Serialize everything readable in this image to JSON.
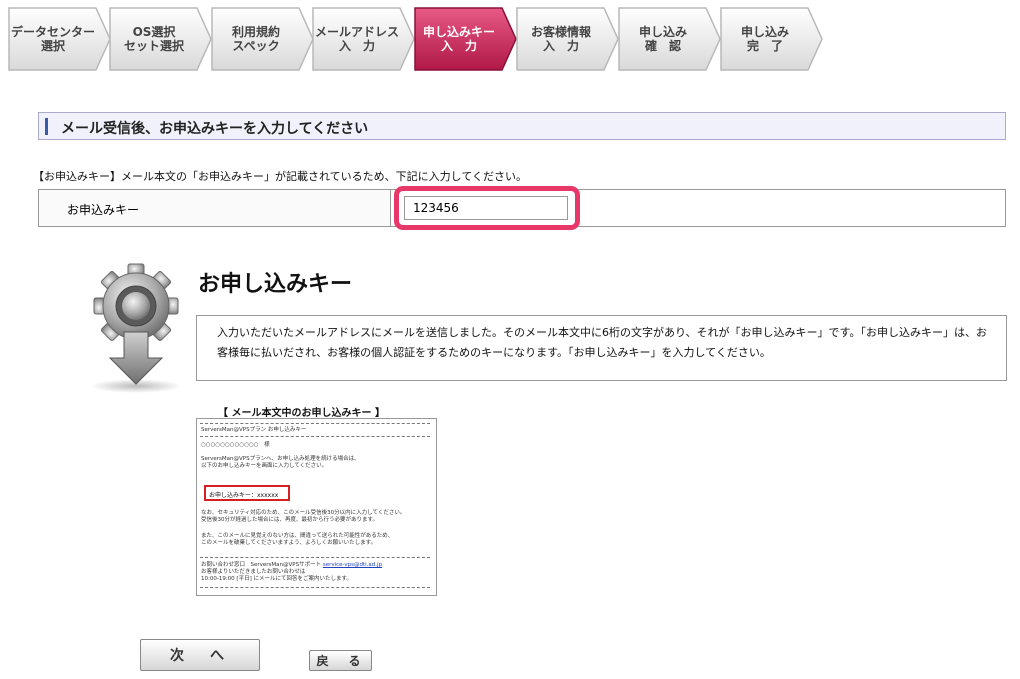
{
  "steps": [
    {
      "line1": "データセンター",
      "line2": "選択",
      "active": false
    },
    {
      "line1": "OS選択",
      "line2": "セット選択",
      "active": false
    },
    {
      "line1": "利用規約",
      "line2": "スペック",
      "active": false
    },
    {
      "line1": "メールアドレス",
      "line2": "入　力",
      "active": false
    },
    {
      "line1": "申し込みキー",
      "line2": "入　力",
      "active": true
    },
    {
      "line1": "お客様情報",
      "line2": "入　力",
      "active": false
    },
    {
      "line1": "申し込み",
      "line2": "確　認",
      "active": false
    },
    {
      "line1": "申し込み",
      "line2": "完　了",
      "active": false
    }
  ],
  "heading": "メール受信後、お申込みキーを入力してください",
  "instruction": "【お申込みキー】メール本文の「お申込みキー」が記載されているため、下記に入力してください。",
  "form": {
    "label": "お申込みキー",
    "value": "123456"
  },
  "info": {
    "title": "お申し込みキー",
    "text": "入力いただいたメールアドレスにメールを送信しました。そのメール本文中に6桁の文字があり、それが「お申し込みキー」です。「お申し込みキー」は、お客様毎に払いだされ、お客様の個人認証をするためのキーになります。「お申し込みキー」を入力してください。"
  },
  "mail_sample": {
    "caption": "【 メール本文中のお申し込みキー 】",
    "subject": "ServersMan@VPSプラン お申し込みキー",
    "addressee": "○○○○○○○○○○○○　様",
    "body1": "ServersMan@VPSプランへ、お申し込み処理を続ける場合は、",
    "body2": "以下のお申し込みキーを画面に入力してください。",
    "key_line": "お申し込みキー：xxxxxx",
    "note1": "なお、セキュリティ対応のため、このメール受信後30分以内に入力してください。",
    "note2": "受信後30分が経過した場合には、再度、最初から行う必要があります。",
    "note3": "また、このメールに見覚えのない方は、間違って送られた可能性があるため、",
    "note4": "このメールを破棄してくださいますよう、よろしくお願いいたします。",
    "contact_prefix": "お問い合わせ窓口　ServersMan@VPSサポート",
    "contact_link": "service-vps@dti.ad.jp",
    "contact2": "お客様よりいただきましたお問い合わせは",
    "contact3": "10:00-19:00 [平日] にメールにて回答をご案内いたします。"
  },
  "buttons": {
    "next": "次　へ",
    "back": "戻　る"
  },
  "colors": {
    "active_step": "#c8245a",
    "highlight_border": "#e8386a",
    "heading_bg": "#f1f1fb",
    "key_box_border": "#d42020"
  }
}
